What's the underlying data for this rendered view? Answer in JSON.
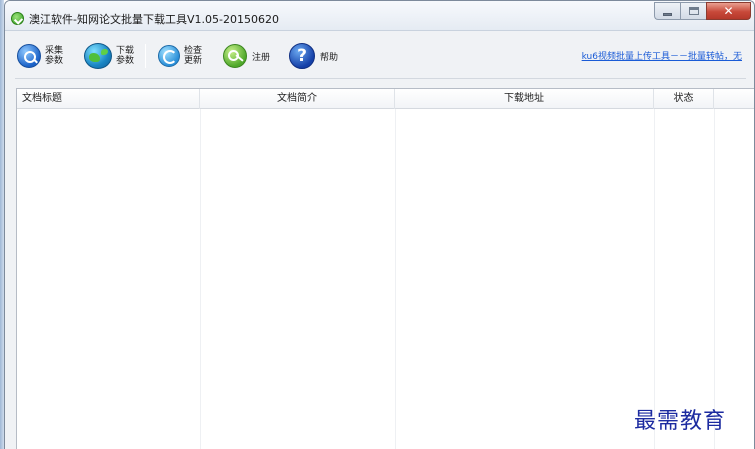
{
  "window": {
    "title": "澳江软件-知网论文批量下载工具V1.05-20150620"
  },
  "caption_buttons": {
    "minimize": "minimize",
    "maximize": "maximize",
    "close_glyph": "✕"
  },
  "toolbar": {
    "collect": {
      "line1": "采集",
      "line2": "参数",
      "icon": "magnifier-globe-icon"
    },
    "download": {
      "line1": "下载",
      "line2": "参数",
      "icon": "earth-globe-icon"
    },
    "update": {
      "line1": "检查",
      "line2": "更新",
      "icon": "refresh-icon"
    },
    "register": {
      "label": "注册",
      "icon": "key-icon"
    },
    "help": {
      "label": "帮助",
      "icon": "help-icon",
      "glyph": "?"
    },
    "promo_link": "ku6视频批量上传工具－－批量转帖，无"
  },
  "table": {
    "columns": [
      "文档标题",
      "文档简介",
      "下载地址",
      "状态"
    ],
    "rows": []
  },
  "watermark": "最需教育"
}
